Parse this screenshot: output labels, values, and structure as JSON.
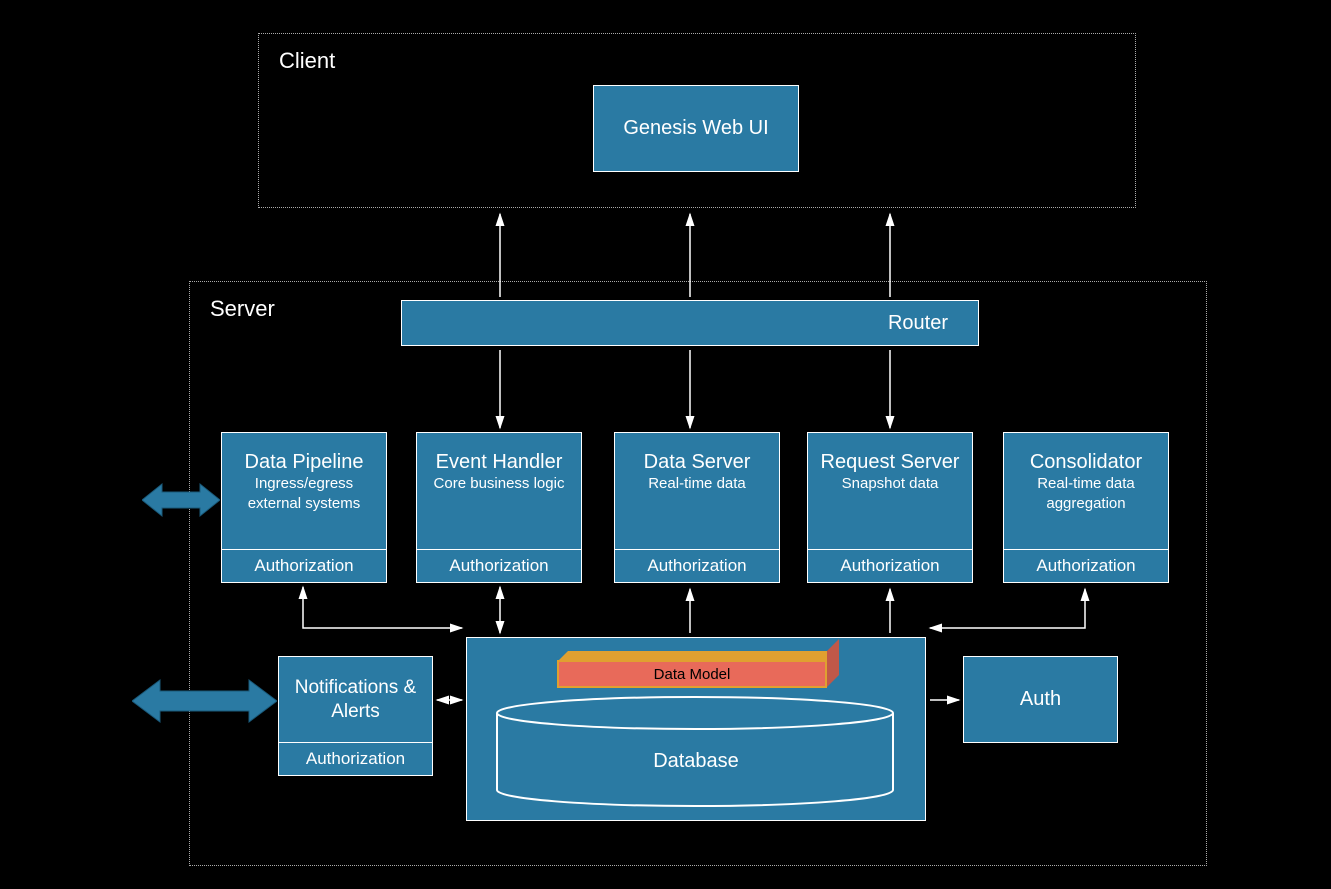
{
  "client": {
    "label": "Client",
    "webui": "Genesis Web UI"
  },
  "server": {
    "label": "Server",
    "router": "Router",
    "boxes": {
      "pipeline": {
        "title": "Data Pipeline",
        "sub": "Ingress/egress external systems",
        "auth": "Authorization"
      },
      "handler": {
        "title": "Event Handler",
        "sub": "Core business logic",
        "auth": "Authorization"
      },
      "dataserver": {
        "title": "Data Server",
        "sub": "Real-time data",
        "auth": "Authorization"
      },
      "requestserver": {
        "title": "Request Server",
        "sub": "Snapshot data",
        "auth": "Authorization"
      },
      "consolidator": {
        "title": "Consolidator",
        "sub": "Real-time data aggregation",
        "auth": "Authorization"
      }
    },
    "notifications": {
      "title": "Notifications & Alerts",
      "auth": "Authorization"
    },
    "database": {
      "label": "Database",
      "datamodel": "Data Model"
    },
    "auth": "Auth"
  }
}
